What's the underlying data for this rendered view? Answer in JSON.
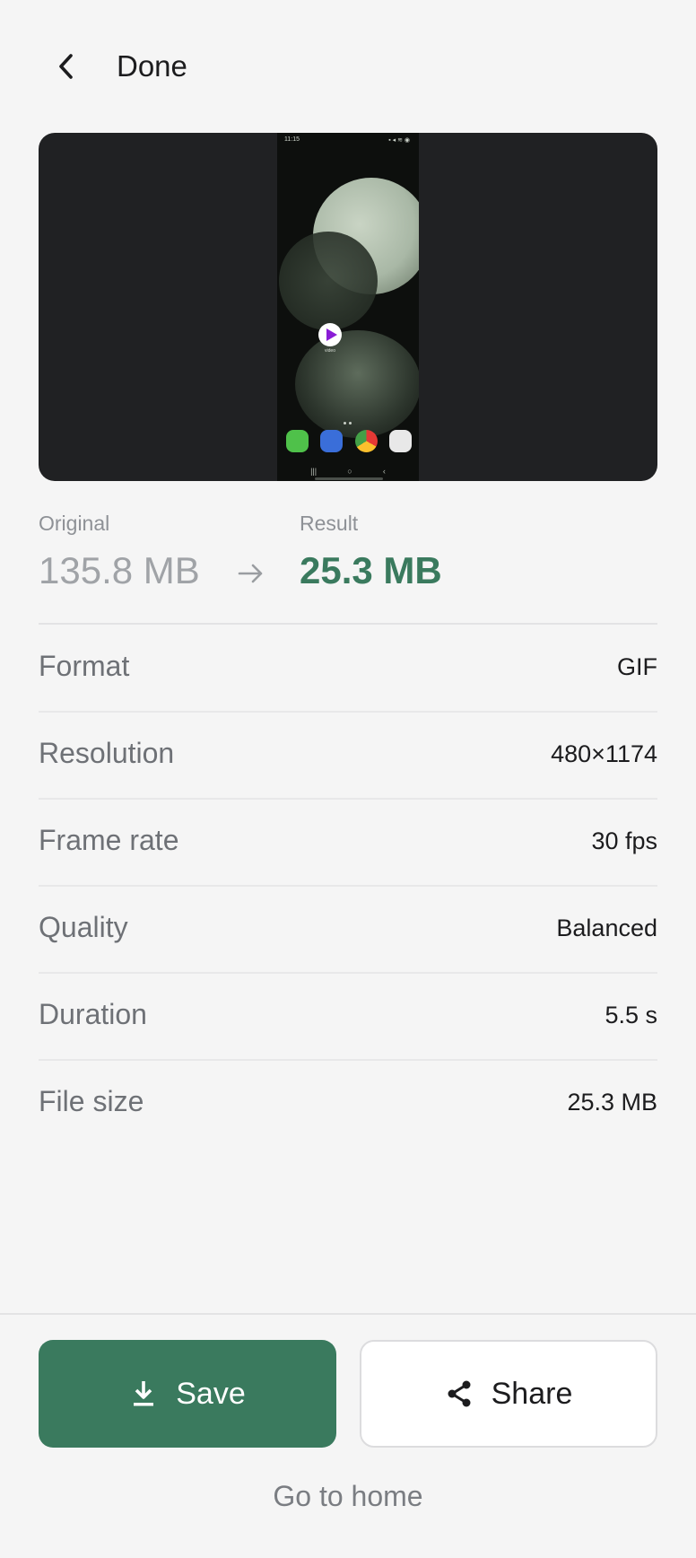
{
  "header": {
    "title": "Done",
    "back_icon": "chevron-left-icon"
  },
  "preview": {
    "status_time": "11:15",
    "app_label": "video"
  },
  "compare": {
    "original_label": "Original",
    "original_value": "135.8 MB",
    "result_label": "Result",
    "result_value": "25.3 MB",
    "arrow_icon": "arrow-right-icon"
  },
  "details": [
    {
      "key": "Format",
      "value": "GIF"
    },
    {
      "key": "Resolution",
      "value": "480×1174"
    },
    {
      "key": "Frame rate",
      "value": "30 fps"
    },
    {
      "key": "Quality",
      "value": "Balanced"
    },
    {
      "key": "Duration",
      "value": "5.5 s"
    },
    {
      "key": "File size",
      "value": "25.3 MB"
    }
  ],
  "actions": {
    "save_label": "Save",
    "save_icon": "download-icon",
    "share_label": "Share",
    "share_icon": "share-icon",
    "home_label": "Go to home"
  },
  "colors": {
    "accent": "#3a7a5e",
    "background": "#f5f5f5",
    "preview_bg": "#202123"
  }
}
